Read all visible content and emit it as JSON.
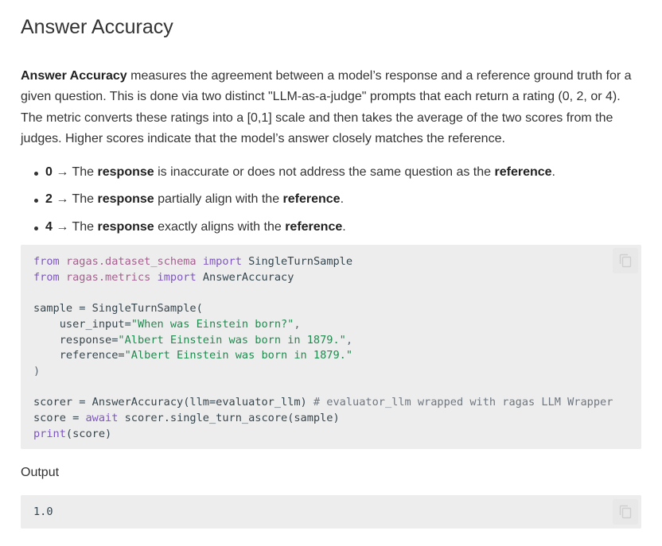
{
  "heading": "Answer Accuracy",
  "intro": {
    "term": "Answer Accuracy",
    "text": " measures the agreement between a model’s response and a reference ground truth for a given question. This is done via two distinct \"LLM-as-a-judge\" prompts that each return a rating (0, 2, or 4). The metric converts these ratings into a [0,1] scale and then takes the average of the two scores from the judges. Higher scores indicate that the model’s answer closely matches the reference."
  },
  "ratings": [
    {
      "score": "0",
      "arrow": " → The ",
      "w1": "response",
      "mid": " is inaccurate or does not address the same question as the ",
      "w2": "reference",
      "end": "."
    },
    {
      "score": "2",
      "arrow": " → The ",
      "w1": "response",
      "mid": " partially align with the ",
      "w2": "reference",
      "end": "."
    },
    {
      "score": "4",
      "arrow": " → The ",
      "w1": "response",
      "mid": " exactly aligns with the ",
      "w2": "reference",
      "end": "."
    }
  ],
  "code": {
    "kw_from": "from",
    "kw_import": "import",
    "mod1": "ragas.dataset_schema",
    "cls1": "SingleTurnSample",
    "mod2": "ragas.metrics",
    "cls2": "AnswerAccuracy",
    "sample_assign": "sample = SingleTurnSample(",
    "arg1_name": "    user_input=",
    "arg1_val": "\"When was Einstein born?\"",
    "arg2_name": "    response=",
    "arg2_val": "\"Albert Einstein was born in 1879.\"",
    "arg3_name": "    reference=",
    "arg3_val": "\"Albert Einstein was born in 1879.\"",
    "close_paren": ")",
    "scorer_line": "scorer = AnswerAccuracy(llm=evaluator_llm) ",
    "scorer_comment": "# evaluator_llm wrapped with ragas LLM Wrapper",
    "score_assign": "score = ",
    "kw_await": "await",
    "score_call": " scorer.single_turn_ascore(sample)",
    "kw_print": "print",
    "print_args": "(score)"
  },
  "output_label": "Output",
  "output_value": "1.0",
  "icons": {
    "copy": "copy-icon"
  }
}
